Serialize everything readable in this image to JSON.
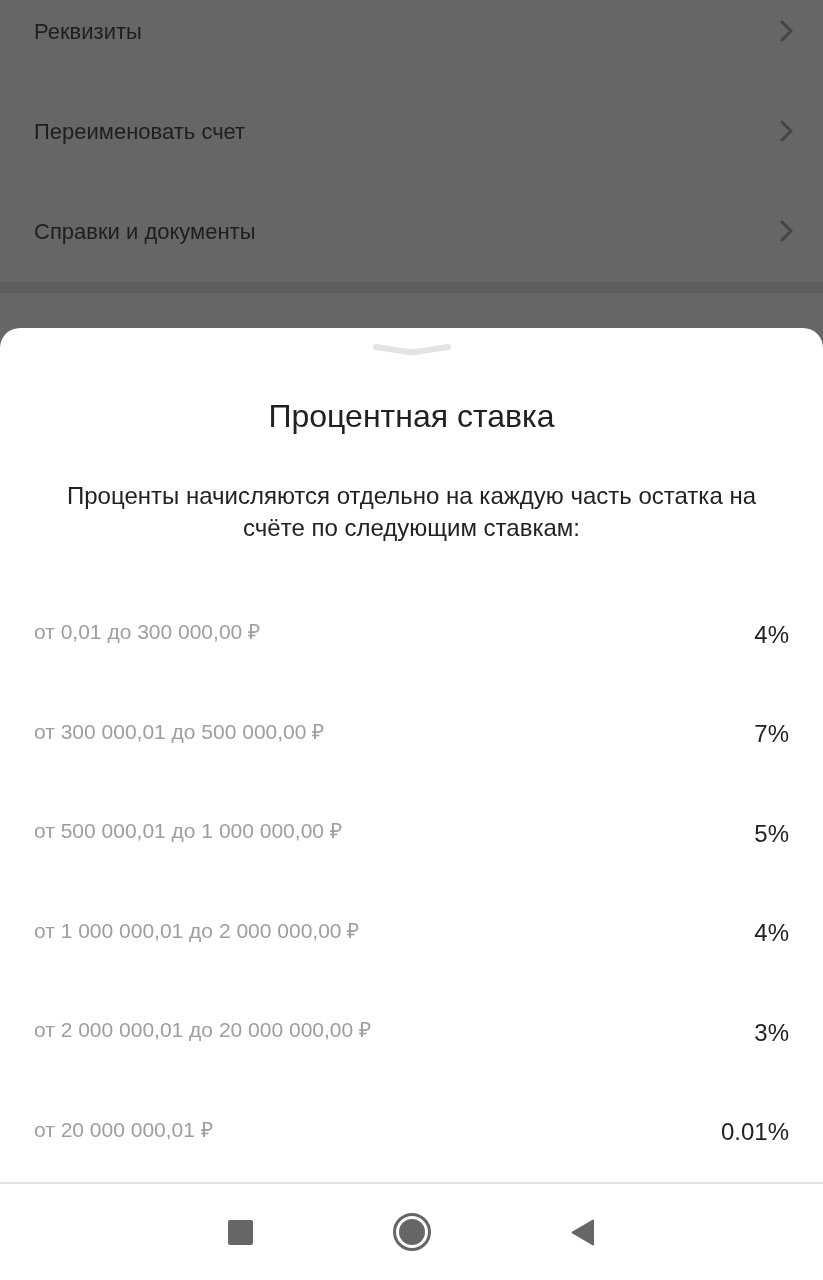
{
  "background_menu": {
    "items": [
      {
        "label": "Реквизиты"
      },
      {
        "label": "Переименовать счет"
      },
      {
        "label": "Справки и документы"
      }
    ]
  },
  "sheet": {
    "title": "Процентная ставка",
    "description": "Проценты начисляются отдельно на каждую часть остатка на счёте по следующим ставкам:",
    "rates": [
      {
        "range": "от 0,01 до 300 000,00 ₽",
        "rate": "4%"
      },
      {
        "range": "от 300 000,01 до 500 000,00 ₽",
        "rate": "7%"
      },
      {
        "range": "от 500 000,01 до 1 000 000,00 ₽",
        "rate": "5%"
      },
      {
        "range": "от 1 000 000,01 до 2 000 000,00 ₽",
        "rate": "4%"
      },
      {
        "range": "от 2 000 000,01 до 20 000 000,00 ₽",
        "rate": "3%"
      },
      {
        "range": "от 20 000 000,01 ₽",
        "rate": "0.01%"
      }
    ]
  }
}
